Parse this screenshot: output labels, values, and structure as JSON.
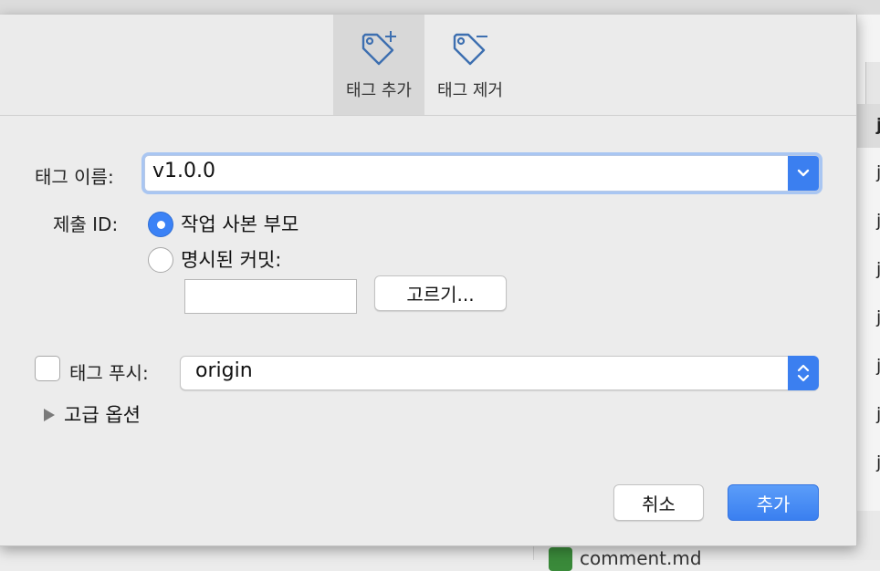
{
  "toolbar": {
    "add_tag_label": "태그 추가",
    "remove_tag_label": "태그 제거"
  },
  "form": {
    "tag_name_label": "태그 이름:",
    "tag_name_value": "v1.0.0",
    "commit_id_label": "제출 ID:",
    "option_working_copy_parent": "작업 사본 부모",
    "option_specified_commit": "명시된 커밋:",
    "specified_commit_value": "",
    "choose_button": "고르기...",
    "push_tag_label": "태그 푸시:",
    "push_tag_checked": false,
    "remote_value": "origin",
    "advanced_options": "고급 옵션"
  },
  "buttons": {
    "cancel": "취소",
    "add": "추가"
  },
  "background": {
    "list_rows": [
      "j",
      "j",
      "j",
      "j",
      "j",
      "j",
      "j",
      "j"
    ],
    "bottom_file": "comment.md"
  },
  "colors": {
    "accent": "#3b7ff0",
    "focus_ring": "#a9c6f2"
  }
}
